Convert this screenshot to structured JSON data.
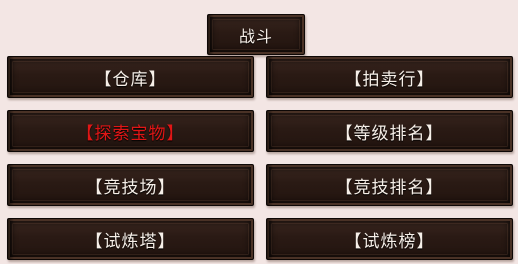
{
  "header": {
    "battle_label": "战斗"
  },
  "menu": {
    "left": [
      {
        "label": "【仓库】"
      },
      {
        "label": "【探索宝物】"
      },
      {
        "label": "【竞技场】"
      },
      {
        "label": "【试炼塔】"
      }
    ],
    "right": [
      {
        "label": "【拍卖行】"
      },
      {
        "label": "【等级排名】"
      },
      {
        "label": "【竞技排名】"
      },
      {
        "label": "【试炼榜】"
      }
    ]
  },
  "colors": {
    "background": "#f3e6e4",
    "button_fill": "#2a1a14",
    "label_text": "#f6efe8",
    "highlight_text": "#e01616"
  }
}
